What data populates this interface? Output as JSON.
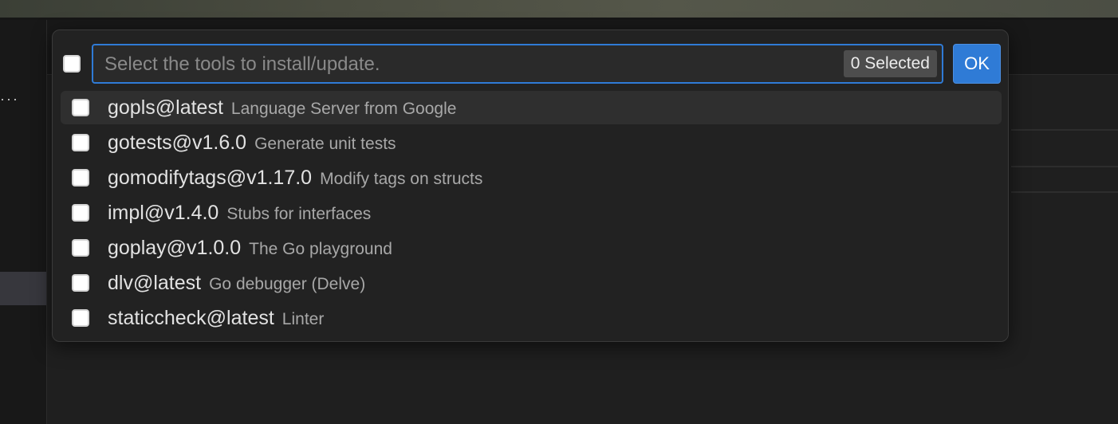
{
  "quick_pick": {
    "filter": {
      "placeholder": "Select the tools to install/update.",
      "value": ""
    },
    "selected_count": "0 Selected",
    "ok_label": "OK",
    "items": [
      {
        "label": "gopls@latest",
        "description": "Language Server from Google",
        "checked": false,
        "focused": true
      },
      {
        "label": "gotests@v1.6.0",
        "description": "Generate unit tests",
        "checked": false,
        "focused": false
      },
      {
        "label": "gomodifytags@v1.17.0",
        "description": "Modify tags on structs",
        "checked": false,
        "focused": false
      },
      {
        "label": "impl@v1.4.0",
        "description": "Stubs for interfaces",
        "checked": false,
        "focused": false
      },
      {
        "label": "goplay@v1.0.0",
        "description": "The Go playground",
        "checked": false,
        "focused": false
      },
      {
        "label": "dlv@latest",
        "description": "Go debugger (Delve)",
        "checked": false,
        "focused": false
      },
      {
        "label": "staticcheck@latest",
        "description": "Linter",
        "checked": false,
        "focused": false
      }
    ]
  },
  "background": {
    "more_actions": "···"
  },
  "colors": {
    "accent": "#2f7bd6",
    "widget_background": "#222222",
    "focused_row": "#2f2f2f",
    "badge": "#4d4d4d"
  }
}
